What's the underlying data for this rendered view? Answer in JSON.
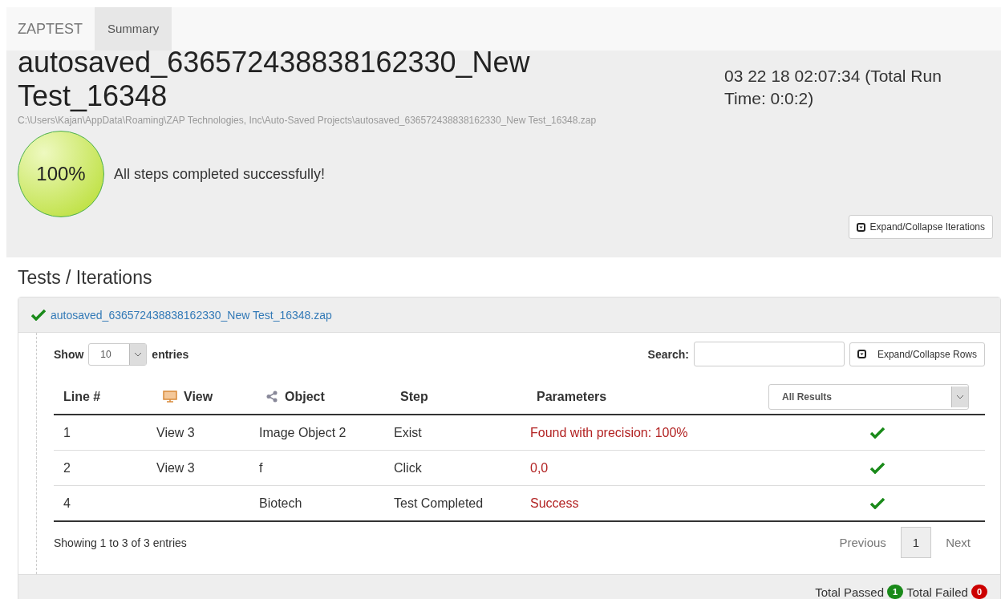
{
  "navbar": {
    "brand": "ZAPTEST",
    "tabs": [
      {
        "label": "Summary",
        "selected": true
      }
    ]
  },
  "header": {
    "title": "autosaved_636572438838162330_New Test_16348",
    "path": "C:\\Users\\Kajan\\AppData\\Roaming\\ZAP Technologies, Inc\\Auto-Saved Projects\\autosaved_636572438838162330_New Test_16348.zap",
    "run_info": "03 22 18 02:07:34 (Total Run Time: 0:0:2)",
    "score": "100%",
    "message": "All steps completed successfully!",
    "expand_button": "Expand/Collapse Iterations"
  },
  "section_title": "Tests / Iterations",
  "iteration": {
    "name": "autosaved_636572438838162330_New Test_16348.zap",
    "passed": true,
    "show_label": "Show",
    "page_size": "10",
    "entries_label": "entries",
    "search_label": "Search:",
    "expand_rows_button": "Expand/Collapse Rows",
    "columns": [
      {
        "label": "Line #",
        "kind": "plain"
      },
      {
        "label": "View",
        "kind": "view"
      },
      {
        "label": "Object",
        "kind": "object"
      },
      {
        "label": "Step",
        "kind": "plain"
      },
      {
        "label": "Parameters",
        "kind": "plain"
      }
    ],
    "result_filter": "All Results",
    "rows": [
      {
        "line": "1",
        "view": "View 3",
        "object": "Image Object 2",
        "step": "Exist",
        "parameters": "Found with precision: 100%",
        "passed": true
      },
      {
        "line": "2",
        "view": "View 3",
        "object": "f",
        "step": "Click",
        "parameters": "0,0",
        "passed": true
      },
      {
        "line": "4",
        "view": "",
        "object": "Biotech",
        "step": "Test Completed",
        "parameters": "Success",
        "passed": true
      }
    ],
    "info": "Showing 1 to 3 of 3 entries",
    "pagination": {
      "previous": "Previous",
      "pages": [
        {
          "label": "1",
          "selected": true
        }
      ],
      "next": "Next"
    }
  },
  "totals": {
    "passed_label": "Total Passed",
    "passed": "1",
    "failed_label": "Total Failed",
    "failed": "0"
  }
}
